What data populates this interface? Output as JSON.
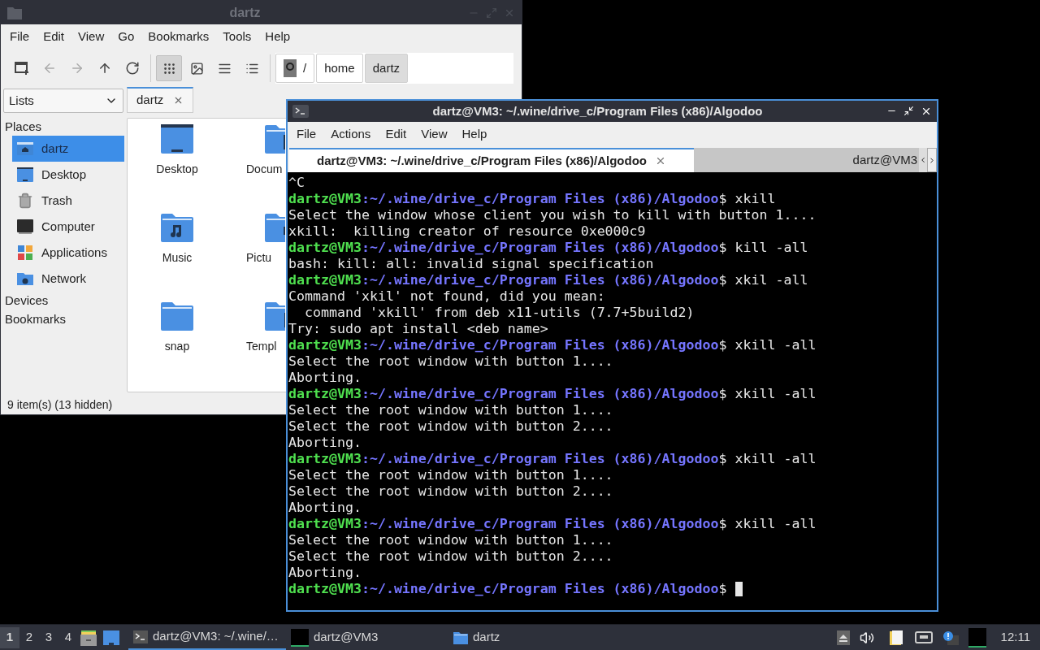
{
  "file_manager": {
    "title": "dartz",
    "menu": [
      "File",
      "Edit",
      "View",
      "Go",
      "Bookmarks",
      "Tools",
      "Help"
    ],
    "toolbar": [
      {
        "kind": "new-tab",
        "disabled": false
      },
      {
        "kind": "back",
        "disabled": true
      },
      {
        "kind": "forward",
        "disabled": true
      },
      {
        "kind": "up",
        "disabled": false
      },
      {
        "kind": "reload",
        "disabled": false
      }
    ],
    "views": [
      {
        "kind": "icons",
        "selected": true
      },
      {
        "kind": "thumbnails",
        "selected": false
      },
      {
        "kind": "compact",
        "selected": false
      },
      {
        "kind": "details",
        "selected": false
      }
    ],
    "path": [
      {
        "kind": "root",
        "label": "/",
        "selected": false
      },
      {
        "kind": "dir",
        "label": "home",
        "selected": false
      },
      {
        "kind": "dir",
        "label": "dartz",
        "selected": true
      }
    ],
    "side_pane_mode": "Lists",
    "tabs": [
      {
        "label": "dartz",
        "selected": true
      }
    ],
    "places_heading": "Places",
    "places": [
      {
        "kind": "home",
        "label": "dartz",
        "selected": true
      },
      {
        "kind": "desktop",
        "label": "Desktop",
        "selected": false
      },
      {
        "kind": "trash",
        "label": "Trash",
        "selected": false
      },
      {
        "kind": "computer",
        "label": "Computer",
        "selected": false
      },
      {
        "kind": "applications",
        "label": "Applications",
        "selected": false
      },
      {
        "kind": "network",
        "label": "Network",
        "selected": false
      }
    ],
    "sections": [
      "Devices",
      "Bookmarks"
    ],
    "files": [
      {
        "kind": "desktop",
        "label": "Desktop"
      },
      {
        "kind": "documents",
        "label": "Docum"
      },
      {
        "kind": "music",
        "label": "Music"
      },
      {
        "kind": "pictures",
        "label": "Pictu"
      },
      {
        "kind": "folder",
        "label": "snap"
      },
      {
        "kind": "templates",
        "label": "Templ"
      }
    ],
    "status": "9 item(s) (13 hidden)"
  },
  "terminal": {
    "title": "dartz@VM3: ~/.wine/drive_c/Program Files (x86)/Algodoo",
    "menu": [
      "File",
      "Actions",
      "Edit",
      "View",
      "Help"
    ],
    "tabs": [
      {
        "label": "dartz@VM3: ~/.wine/drive_c/Program Files (x86)/Algodoo",
        "selected": true
      },
      {
        "label": "dartz@VM3",
        "selected": false
      }
    ],
    "lines": [
      {
        "kind": "output",
        "text": "^C"
      },
      {
        "kind": "prompt",
        "user": "dartz@VM3",
        "path": ":~/.wine/drive_c/Program Files (x86)/Algodoo",
        "command": "$ xkill"
      },
      {
        "kind": "output",
        "text": "Select the window whose client you wish to kill with button 1...."
      },
      {
        "kind": "output",
        "text": "xkill:  killing creator of resource 0xe000c9"
      },
      {
        "kind": "prompt",
        "user": "dartz@VM3",
        "path": ":~/.wine/drive_c/Program Files (x86)/Algodoo",
        "command": "$ kill -all"
      },
      {
        "kind": "output",
        "text": "bash: kill: all: invalid signal specification"
      },
      {
        "kind": "prompt",
        "user": "dartz@VM3",
        "path": ":~/.wine/drive_c/Program Files (x86)/Algodoo",
        "command": "$ xkil -all"
      },
      {
        "kind": "output",
        "text": "Command 'xkil' not found, did you mean:"
      },
      {
        "kind": "output",
        "text": "  command 'xkill' from deb x11-utils (7.7+5build2)"
      },
      {
        "kind": "output",
        "text": "Try: sudo apt install <deb name>"
      },
      {
        "kind": "prompt",
        "user": "dartz@VM3",
        "path": ":~/.wine/drive_c/Program Files (x86)/Algodoo",
        "command": "$ xkill -all"
      },
      {
        "kind": "output",
        "text": "Select the root window with button 1...."
      },
      {
        "kind": "output",
        "text": "Aborting."
      },
      {
        "kind": "prompt",
        "user": "dartz@VM3",
        "path": ":~/.wine/drive_c/Program Files (x86)/Algodoo",
        "command": "$ xkill -all"
      },
      {
        "kind": "output",
        "text": "Select the root window with button 1...."
      },
      {
        "kind": "output",
        "text": "Select the root window with button 2...."
      },
      {
        "kind": "output",
        "text": "Aborting."
      },
      {
        "kind": "prompt",
        "user": "dartz@VM3",
        "path": ":~/.wine/drive_c/Program Files (x86)/Algodoo",
        "command": "$ xkill -all"
      },
      {
        "kind": "output",
        "text": "Select the root window with button 1...."
      },
      {
        "kind": "output",
        "text": "Select the root window with button 2...."
      },
      {
        "kind": "output",
        "text": "Aborting."
      },
      {
        "kind": "prompt",
        "user": "dartz@VM3",
        "path": ":~/.wine/drive_c/Program Files (x86)/Algodoo",
        "command": "$ xkill -all"
      },
      {
        "kind": "output",
        "text": "Select the root window with button 1...."
      },
      {
        "kind": "output",
        "text": "Select the root window with button 2...."
      },
      {
        "kind": "output",
        "text": "Aborting."
      },
      {
        "kind": "prompt",
        "user": "dartz@VM3",
        "path": ":~/.wine/drive_c/Program Files (x86)/Algodoo",
        "command": "$",
        "cursor": true
      }
    ]
  },
  "taskbar": {
    "workspaces": [
      {
        "label": "1",
        "selected": true
      },
      {
        "label": "2",
        "selected": false
      },
      {
        "label": "3",
        "selected": false
      },
      {
        "label": "4",
        "selected": false
      }
    ],
    "tasks": [
      {
        "kind": "terminal",
        "label": "dartz@VM3: ~/.wine/…",
        "selected": true
      },
      {
        "kind": "window",
        "label": "dartz@VM3",
        "selected": false
      },
      {
        "kind": "folder",
        "label": "dartz",
        "selected": false
      }
    ],
    "clock": "12:11"
  }
}
